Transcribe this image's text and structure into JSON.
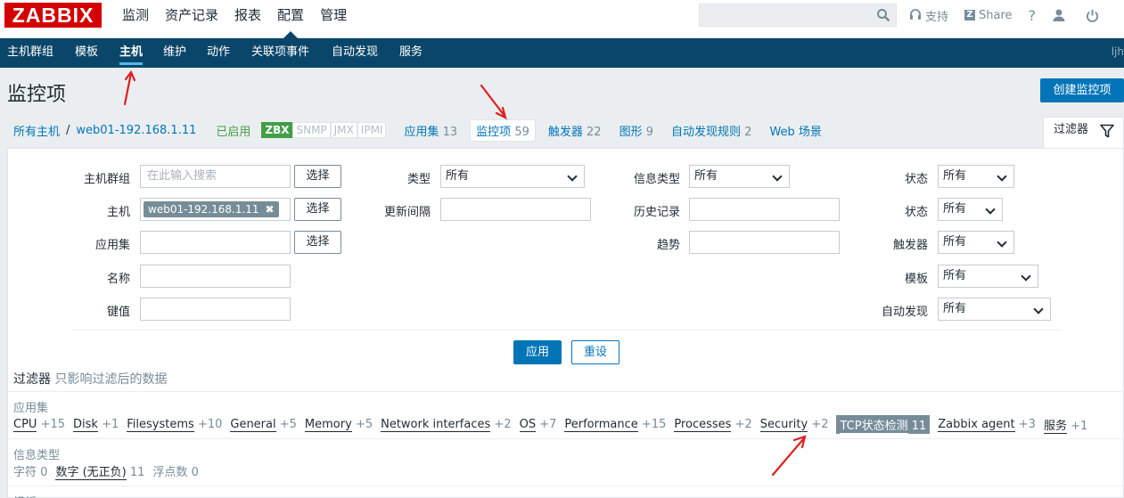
{
  "top": {
    "logo": "ZABBIX",
    "menu": [
      "监测",
      "资产记录",
      "报表",
      "配置",
      "管理"
    ],
    "active_menu": "配置",
    "support": "支持",
    "share": "Share",
    "help": "?"
  },
  "subnav": {
    "items": [
      "主机群组",
      "模板",
      "主机",
      "维护",
      "动作",
      "关联项事件",
      "自动发现",
      "服务"
    ],
    "active": "主机",
    "user": "ljh"
  },
  "page": {
    "title": "监控项",
    "create_button": "创建监控项"
  },
  "hostnav": {
    "all_hosts": "所有主机",
    "separator": "/",
    "host": "web01-192.168.1.11",
    "status": "已启用",
    "badges": [
      "ZBX",
      "SNMP",
      "JMX",
      "IPMI"
    ],
    "tabs": [
      {
        "label": "应用集",
        "count": "13"
      },
      {
        "label": "监控项",
        "count": "59"
      },
      {
        "label": "触发器",
        "count": "22"
      },
      {
        "label": "图形",
        "count": "9"
      },
      {
        "label": "自动发现规则",
        "count": "2"
      },
      {
        "label": "Web 场景",
        "count": ""
      }
    ],
    "filter_tab": "过滤器"
  },
  "filter": {
    "host_group_label": "主机群组",
    "host_group_placeholder": "在此输入搜索",
    "select_label": "选择",
    "host_label": "主机",
    "host_chip": "web01-192.168.1.11",
    "app_label": "应用集",
    "name_label": "名称",
    "key_label": "键值",
    "type_label": "类型",
    "type_value": "所有",
    "interval_label": "更新间隔",
    "info_type_label": "信息类型",
    "info_type_value": "所有",
    "history_label": "历史记录",
    "trends_label": "趋势",
    "state_label": "状态",
    "state_value": "所有",
    "status_label": "状态",
    "status_value": "所有",
    "triggers_label": "触发器",
    "triggers_value": "所有",
    "template_label": "模板",
    "template_value": "所有",
    "discovery_label": "自动发现",
    "discovery_value": "所有",
    "apply": "应用",
    "reset": "重设"
  },
  "subfilter": {
    "title": "过滤器",
    "hint": "只影响过滤后的数据",
    "apps_heading": "应用集",
    "apps": [
      {
        "name": "CPU",
        "count": "+15"
      },
      {
        "name": "Disk",
        "count": "+1"
      },
      {
        "name": "Filesystems",
        "count": "+10"
      },
      {
        "name": "General",
        "count": "+5"
      },
      {
        "name": "Memory",
        "count": "+5"
      },
      {
        "name": "Network interfaces",
        "count": "+2"
      },
      {
        "name": "OS",
        "count": "+7"
      },
      {
        "name": "Performance",
        "count": "+15"
      },
      {
        "name": "Processes",
        "count": "+2"
      },
      {
        "name": "Security",
        "count": "+2"
      },
      {
        "name": "TCP状态检测",
        "count": "11",
        "selected": true
      },
      {
        "name": "Zabbix agent",
        "count": "+3"
      },
      {
        "name": "服务",
        "count": "+1"
      }
    ],
    "info_heading": "信息类型",
    "info_types": [
      {
        "name": "字符",
        "count": "0",
        "plain": true
      },
      {
        "name": "数字 (无正负)",
        "count": "11"
      },
      {
        "name": "浮点数",
        "count": "0",
        "plain": true
      }
    ],
    "template_heading": "模板"
  },
  "colors": {
    "brand_red": "#d40000",
    "nav_blue": "#0a466a",
    "accent_blue": "#0275b8",
    "enabled_green": "#429e47",
    "annotation_red": "#e01e1e"
  }
}
